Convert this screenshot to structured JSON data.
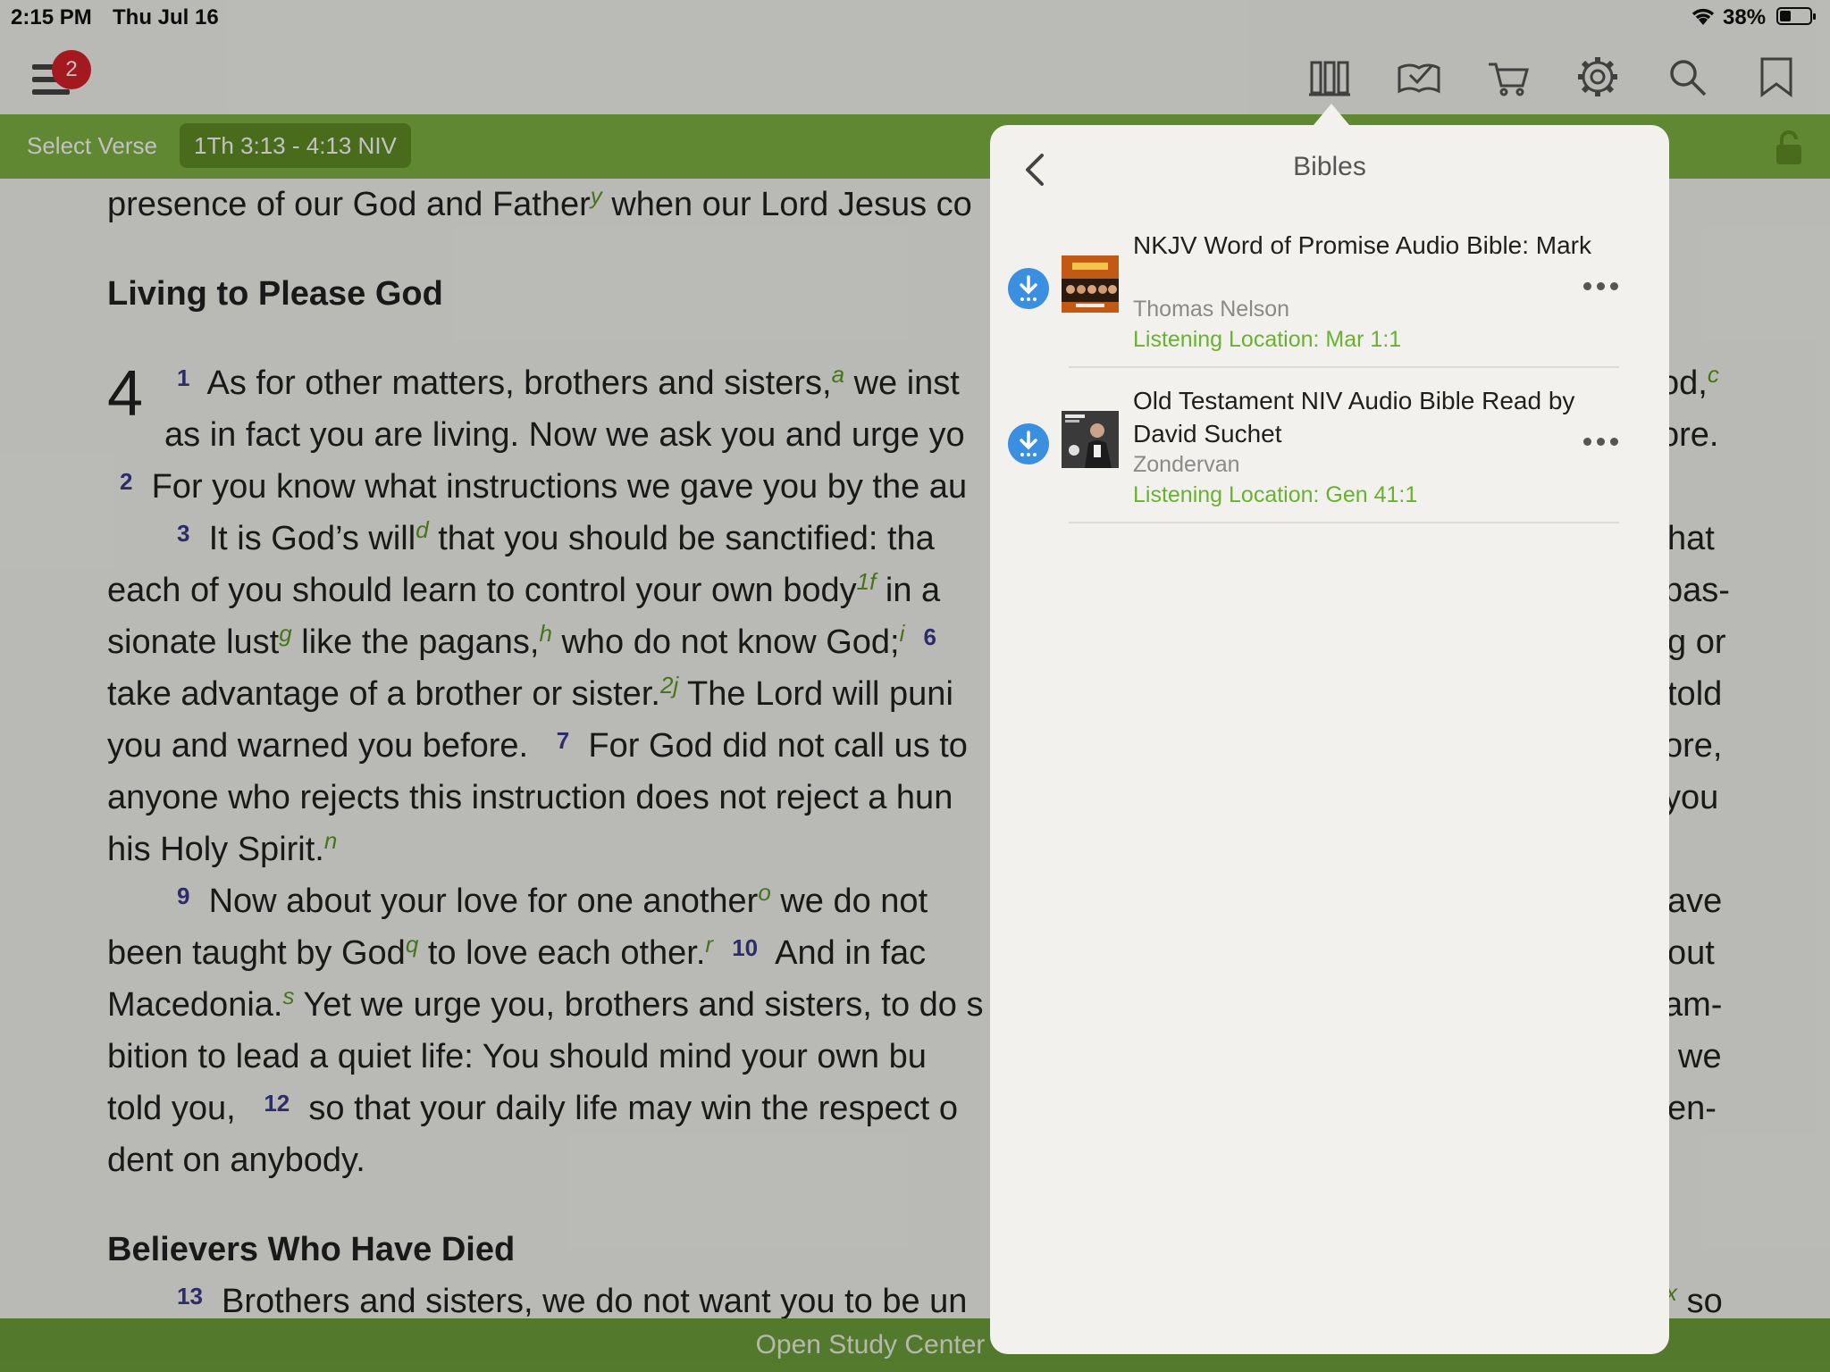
{
  "status_bar": {
    "time": "2:15 PM",
    "date": "Thu Jul 16",
    "battery": "38%"
  },
  "toolbar": {
    "notification_count": "2",
    "icons": [
      "menu-icon",
      "library-icon",
      "reading-plan-icon",
      "cart-icon",
      "settings-icon",
      "search-icon",
      "bookmark-icon"
    ]
  },
  "passage_bar": {
    "select_verse": "Select Verse",
    "reference": "1Th 3:13 - 4:13 NIV"
  },
  "reader": {
    "line0": "presence of our God and Father",
    "line0b": " when our Lord Jesus co",
    "heading1": "Living to Please God",
    "chapter": "4",
    "line1a": "As for other matters, brothers and sisters,",
    "line1b": " we inst",
    "line1c": "od,",
    "line2a": "as in fact you are living. Now we ask you and urge yo",
    "line2b": "ore.",
    "line3": "For you know what instructions we gave you by the au",
    "line4a": "It is God’s will",
    "line4b": " that you should be sanctified: tha",
    "line4c": "hat",
    "line5a": "each of you should learn to control your own body",
    "line5b": " in a",
    "line5c": "pas-",
    "line6a": "sionate lust",
    "line6b": " like the pagans,",
    "line6c": " who do not know God;",
    "line6d": "g or",
    "line7a": "take advantage of a brother or sister.",
    "line7b": " The Lord will puni",
    "line7c": "told",
    "line8a": "you and warned you before.",
    "line8b": "For God did not call us to",
    "line8c": "ore,",
    "line9a": "anyone who rejects this instruction does not reject a hun",
    "line9b": "you",
    "line10": "his Holy Spirit.",
    "line11a": "Now about your love for one another",
    "line11b": " we do not",
    "line11c": "ave",
    "line12a": "been taught by God",
    "line12b": " to love each other.",
    "line12c": "And in fac",
    "line12d": "out",
    "line13a": "Macedonia.",
    "line13b": " Yet we urge you, brothers and sisters, to do s",
    "line13c": "am-",
    "line14a": "bition to lead a quiet life: You should mind your own bu",
    "line14b": "we",
    "line15a": "told you,",
    "line15b": "so that your daily life may win the respect o",
    "line15c": "en-",
    "line16": "dent on anybody.",
    "heading2": "Believers Who Have Died",
    "line17a": "Brothers and sisters, we do not want you to be un",
    "line17b": "so",
    "verse_numbers": {
      "v1": "1",
      "v2": "2",
      "v3": "3",
      "v6": "6",
      "v7": "7",
      "v9": "9",
      "v10": "10",
      "v12": "12",
      "v13": "13"
    },
    "footnotes": {
      "y": "y",
      "a": "a",
      "c": "c",
      "d": "d",
      "f": "1f",
      "g": "g",
      "h": "h",
      "i": "i",
      "j": "2j",
      "n": "n",
      "o": "o",
      "q": "q",
      "r": "r",
      "s": "s",
      "x": "x"
    }
  },
  "bottom_bar": {
    "label": "Open Study Center"
  },
  "popover": {
    "title": "Bibles",
    "items": [
      {
        "title": "NKJV Word of Promise Audio Bible: Mark",
        "publisher": "Thomas Nelson",
        "location": "Listening Location: Mar 1:1"
      },
      {
        "title": "Old Testament NIV Audio Bible Read by David Suchet",
        "publisher": "Zondervan",
        "location": "Listening Location: Gen 41:1"
      }
    ]
  },
  "colors": {
    "accent_green": "#7fb241",
    "link_green": "#6ab131",
    "download_blue": "#3b8fe0",
    "badge_red": "#d8202a"
  }
}
